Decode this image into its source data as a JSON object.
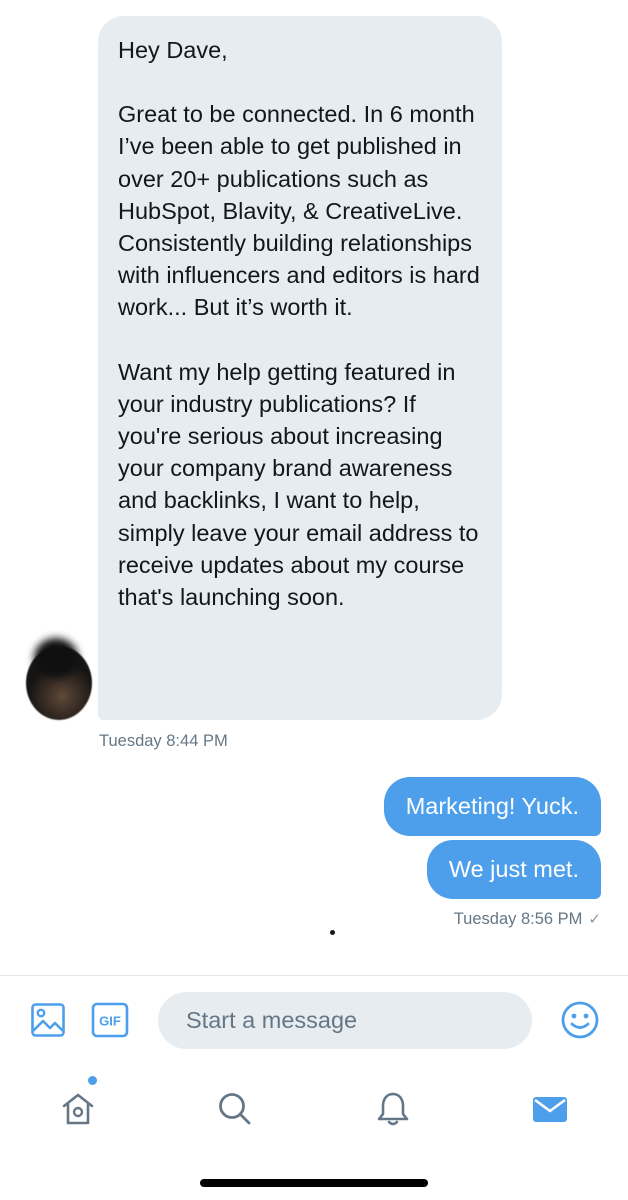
{
  "thread": {
    "incoming": {
      "paragraphs": [
        "Hey Dave,",
        "Great to be connected. In 6 month I’ve been able to get published in over 20+ publications such as HubSpot, Blavity, & CreativeLive. Consistently building relationships with influencers and editors is hard work... But it’s worth it.",
        "Want my help getting featured in your industry publications? If you're serious about increasing your company brand awareness and backlinks, I want to help, simply leave your email address to receive updates about my course that's launching soon."
      ],
      "timestamp": "Tuesday 8:44 PM"
    },
    "outgoing": {
      "messages": [
        "Marketing! Yuck.",
        "We just met."
      ],
      "timestamp": "Tuesday 8:56 PM",
      "status_icon": "check-icon"
    }
  },
  "composer": {
    "placeholder": "Start a message",
    "gif_label": "GIF",
    "icons": [
      "image-icon",
      "gif-icon",
      "emoji-icon"
    ]
  },
  "tabbar": {
    "tabs": [
      {
        "name": "home",
        "icon": "home-icon",
        "has_notification_dot": true
      },
      {
        "name": "search",
        "icon": "search-icon",
        "has_notification_dot": false
      },
      {
        "name": "notifications",
        "icon": "bell-icon",
        "has_notification_dot": false
      },
      {
        "name": "messages",
        "icon": "mail-icon",
        "active": true
      }
    ]
  },
  "colors": {
    "accent": "#4d9fec",
    "incoming_bubble": "#e6ecf0",
    "muted_text": "#657786",
    "tab_inactive": "#657786"
  }
}
